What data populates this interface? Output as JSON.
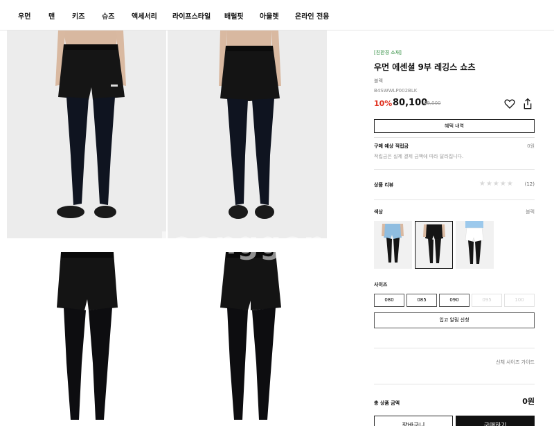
{
  "nav": {
    "items": [
      "우먼",
      "맨",
      "키즈",
      "슈즈",
      "액세서리",
      "라이프스타일",
      "배럴핏",
      "아울렛",
      "온라인 전용"
    ]
  },
  "gallery": {
    "watermark": "Joonggona"
  },
  "product": {
    "eco_badge": "[친환경 소재]",
    "name": "우먼 에센셜 9부 레깅스 쇼츠",
    "color_name": "블랙",
    "sku": "B4SWWLP002BLK",
    "discount": "10%",
    "price": "80,100",
    "original_price": "89,000"
  },
  "benefit_button": "혜택 내역",
  "points": {
    "title": "구매 예상 적립금",
    "value": "0원",
    "description": "적립금은 실제 결제 금액에 따라 달라집니다."
  },
  "reviews": {
    "title": "상품 리뷰",
    "stars": "★★★★★",
    "count": "(12)"
  },
  "color": {
    "label": "색상",
    "selected": "블랙",
    "swatches": [
      "light-blue",
      "black",
      "white"
    ]
  },
  "size": {
    "label": "사이즈",
    "options": [
      "080",
      "085",
      "090",
      "095",
      "100"
    ],
    "disabled": [
      "095",
      "100"
    ]
  },
  "notify_button": "입고 알림 신청",
  "size_guide": "신체 사이즈 가이드",
  "total": {
    "label": "총 상품 금액",
    "value": "0원"
  },
  "actions": {
    "cart": "장바구니",
    "buy": "구매하기"
  },
  "colors": {
    "discount": "#e0301e",
    "eco": "#2a8a3a",
    "buy_bg": "#111111"
  }
}
